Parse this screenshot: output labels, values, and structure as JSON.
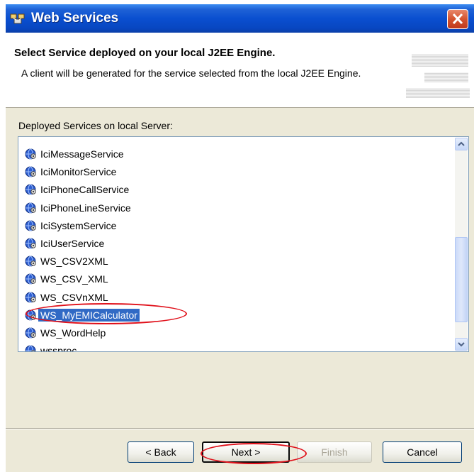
{
  "window": {
    "title": "Web Services",
    "close_icon": "close-icon"
  },
  "header": {
    "title": "Select Service deployed on your local J2EE Engine.",
    "description": "A client will be generated for the service selected from the local J2EE Engine."
  },
  "services": {
    "label": "Deployed Services on local Server:",
    "items": [
      {
        "label": "IciMessageService"
      },
      {
        "label": "IciMonitorService"
      },
      {
        "label": "IciPhoneCallService"
      },
      {
        "label": "IciPhoneLineService"
      },
      {
        "label": "IciSystemService"
      },
      {
        "label": "IciUserService"
      },
      {
        "label": "WS_CSV2XML"
      },
      {
        "label": "WS_CSV_XML"
      },
      {
        "label": "WS_CSVnXML"
      },
      {
        "label": "WS_MyEMICalculator",
        "selected": true
      },
      {
        "label": "WS_WordHelp"
      },
      {
        "label": "wssproc"
      }
    ],
    "item_icon": "globe-service-icon"
  },
  "buttons": {
    "back": "< Back",
    "next": "Next >",
    "finish": "Finish",
    "cancel": "Cancel"
  },
  "colors": {
    "titlebar": "#0a4fd0",
    "selection": "#316ac5",
    "annotation": "#e0101a",
    "dialog_bg": "#ece9d8"
  }
}
